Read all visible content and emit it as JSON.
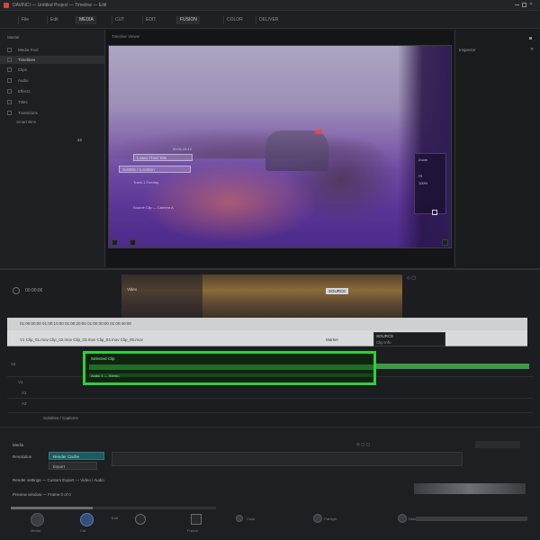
{
  "window": {
    "title": "DAVINCI  —  Untitled Project — Timeline — Edit",
    "accent": "#2fcf3a",
    "viewer_bg": "#6e4aa3"
  },
  "menu": {
    "items": [
      {
        "label": "File"
      },
      {
        "label": "Edit"
      },
      {
        "label": "MEDIA"
      },
      {
        "label": "CUT"
      },
      {
        "label": "EDIT"
      },
      {
        "label": "FUSION"
      },
      {
        "label": "COLOR"
      },
      {
        "label": "DELIVER"
      }
    ]
  },
  "left_panel": {
    "header": "Master",
    "rows": [
      {
        "label": "Media Pool"
      },
      {
        "label": "Timelines"
      },
      {
        "label": "Clips"
      },
      {
        "label": "Audio"
      },
      {
        "label": "Effects"
      },
      {
        "label": "Titles"
      },
      {
        "label": "Transitions"
      }
    ],
    "footer": "Smart Bins",
    "count": "42"
  },
  "viewer": {
    "header": "Timeline Viewer",
    "overlay_text_1": "Lower Third Title",
    "overlay_text_2": "Subtitle / Location",
    "overlay_text_3": "Track 1 Overlay",
    "overlay_text_4": "00:01:24:12",
    "overlay_text_5": "Source Clip — Camera A",
    "right_labels": [
      "Zoom",
      "Fit",
      "100%"
    ]
  },
  "right_panel": {
    "header": "Inspector",
    "close_icon": "close-icon"
  },
  "timeline": {
    "timecode": "00:00:00",
    "track_label": "Video",
    "ruler_row_1": "01:00:00:00   01:00:10:00   01:00:20:00   01:00:30:00   01:00:40:00",
    "ruler_row_2": "V1   Clip_01.mov   Clip_02.mov   Clip_03.mov   Clip_04.mov   Clip_05.mov",
    "badge": "SOURCE",
    "badge_sub": "Clip Info",
    "ruler_right": "Marker",
    "green_clip_label": "Selected Clip",
    "green_clip_sub": "Audio 1 — Stereo",
    "track_rows": [
      {
        "label": "V2"
      },
      {
        "label": "V1"
      },
      {
        "label": "A1"
      },
      {
        "label": "A2"
      }
    ],
    "bottom_row_label": "Subtitles / Captions"
  },
  "bottom": {
    "tab": "Media",
    "field_label": "Resolution",
    "teal_button": "Render Cache",
    "button_2": "Export",
    "row_text_1": "Render settings — Custom Export — Video / Audio",
    "row_text_2": "Preview window — Frame 0 of 0",
    "progress": 0.4,
    "dock": [
      {
        "icon": "media-icon",
        "label": "Media"
      },
      {
        "icon": "cut-icon",
        "label": "Cut"
      },
      {
        "icon": "edit-icon",
        "label": "Edit"
      },
      {
        "icon": "fusion-icon",
        "label": "Fusion"
      },
      {
        "icon": "color-icon",
        "label": "Color"
      },
      {
        "icon": "fairlight-icon",
        "label": "Fairlight"
      },
      {
        "icon": "deliver-icon",
        "label": "Deliver"
      }
    ]
  }
}
